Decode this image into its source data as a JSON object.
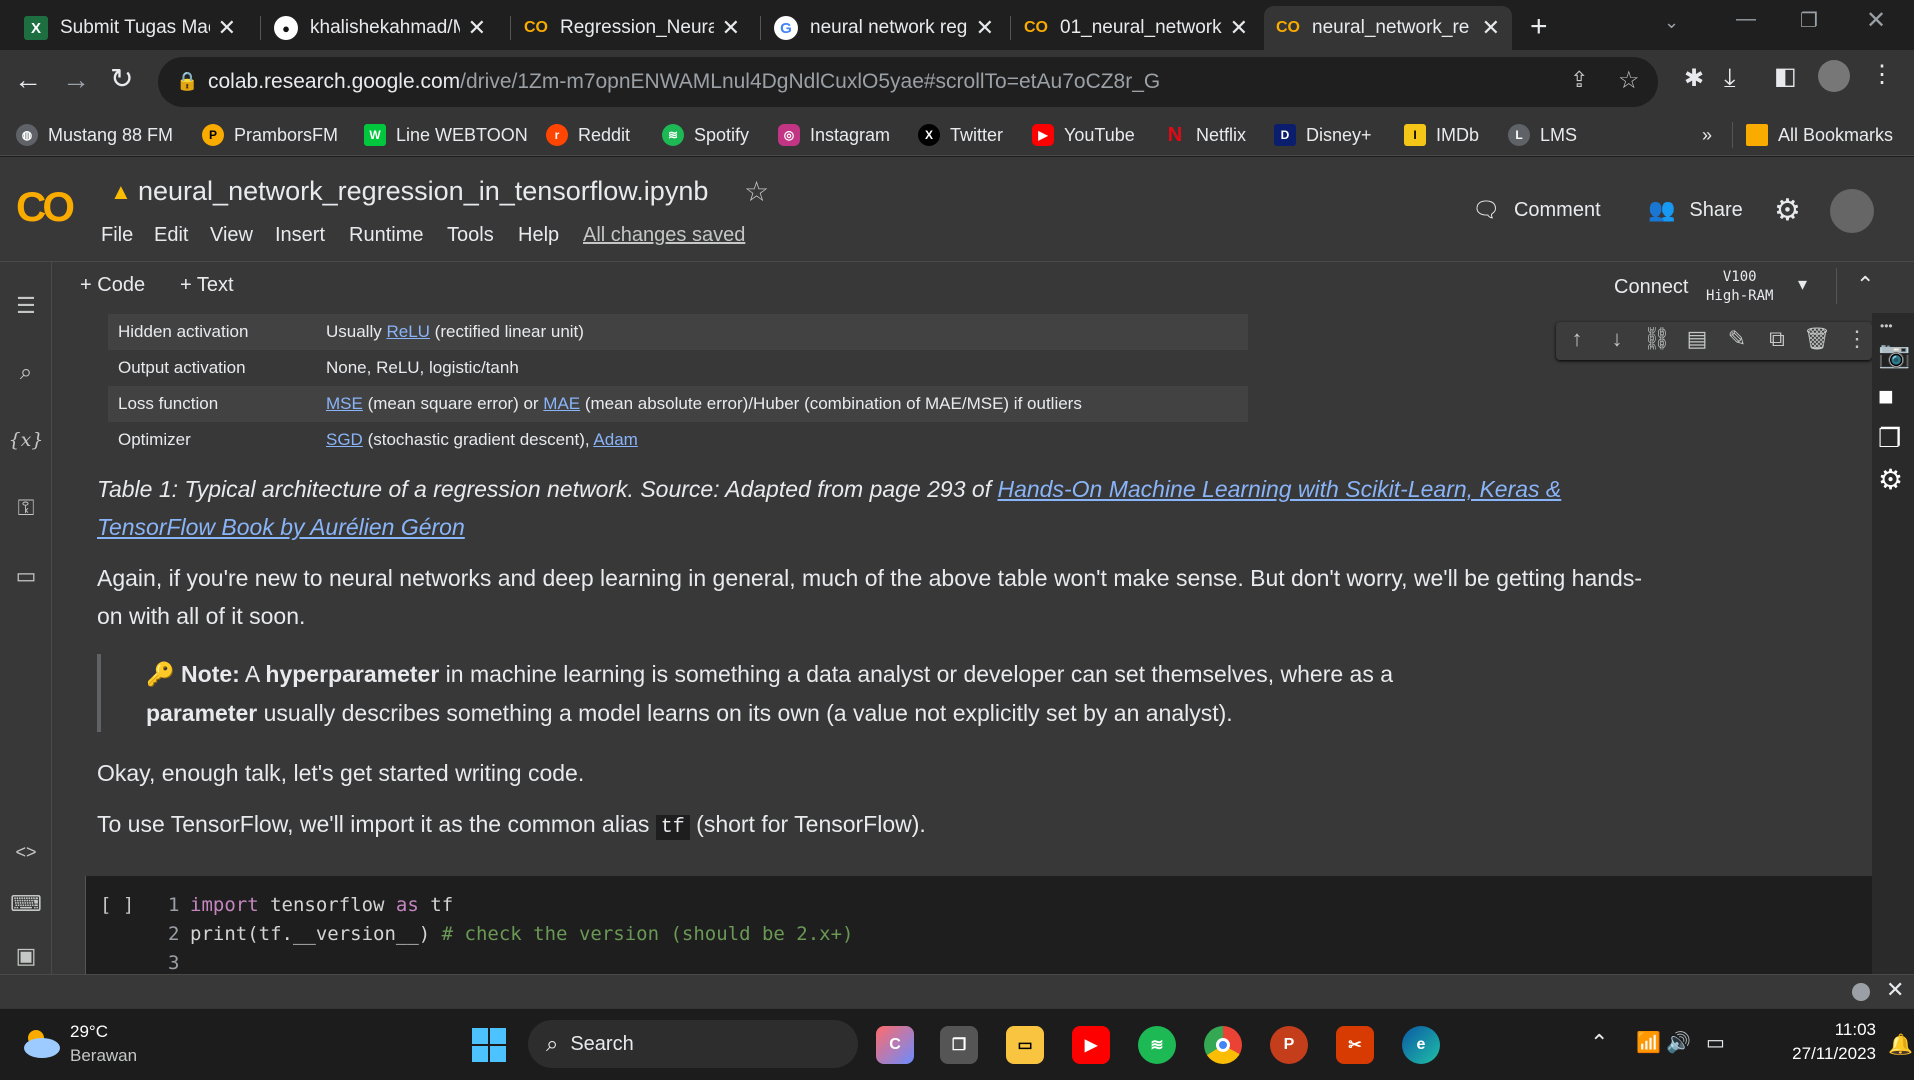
{
  "browser": {
    "tabs": [
      {
        "title": "Submit Tugas Mac",
        "icon": "excel-icon"
      },
      {
        "title": "khalishekahmad/M",
        "icon": "github-icon"
      },
      {
        "title": "Regression_Neural",
        "icon": "colab-icon"
      },
      {
        "title": "neural network reg",
        "icon": "google-icon"
      },
      {
        "title": "01_neural_network",
        "icon": "colab-icon"
      },
      {
        "title": "neural_network_re",
        "icon": "colab-icon"
      }
    ],
    "url_host": "colab.research.google.com",
    "url_path": "/drive/1Zm-m7opnENWAMLnul4DgNdlCuxlO5yae#scrollTo=etAu7oCZ8r_G",
    "bookmarks": [
      "Mustang 88 FM",
      "PramborsFM",
      "Line WEBTOON",
      "Reddit",
      "Spotify",
      "Instagram",
      "Twitter",
      "YouTube",
      "Netflix",
      "Disney+",
      "IMDb",
      "LMS"
    ],
    "all_bookmarks": "All Bookmarks",
    "overflow": "»"
  },
  "colab": {
    "logo": "CO",
    "filename": "neural_network_regression_in_tensorflow.ipynb",
    "menu": [
      "File",
      "Edit",
      "View",
      "Insert",
      "Runtime",
      "Tools",
      "Help"
    ],
    "saved": "All changes saved",
    "comment": "Comment",
    "share": "Share",
    "add_code": "Code",
    "add_text": "Text",
    "connect": "Connect",
    "runtime_gpu": "V100",
    "runtime_ram": "High-RAM"
  },
  "table": {
    "rows": [
      {
        "label": "Hidden activation",
        "pre": "Usually ",
        "link": "ReLU",
        "post": " (rectified linear unit)"
      },
      {
        "label": "Output activation",
        "pre": "None, ReLU, logistic/tanh",
        "link": "",
        "post": ""
      },
      {
        "label": "Loss function",
        "pre": "",
        "link": "MSE",
        "post": " (mean square error) or ",
        "link2": "MAE",
        "post2": " (mean absolute error)/Huber (combination of MAE/MSE) if outliers"
      },
      {
        "label": "Optimizer",
        "pre": "",
        "link": "SGD",
        "post": " (stochastic gradient descent), ",
        "link2": "Adam",
        "post2": ""
      }
    ]
  },
  "text": {
    "caption_pre": "Table 1: Typical architecture of a regression network. Source: Adapted from page 293 of ",
    "caption_link1": "Hands-On Machine Learning with Scikit-Learn, Keras &",
    "caption_link2": "TensorFlow Book by Aurélien Géron",
    "para1": "Again, if you're new to neural networks and deep learning in general, much of the above table won't make sense. But don't worry, we'll be getting hands-on with all of it soon.",
    "note_emoji": "🔑",
    "note_label": "Note:",
    "note_a": " A ",
    "note_b": "hyperparameter",
    "note_c": " in machine learning is something a data analyst or developer can set themselves, where as a",
    "note_d": "parameter",
    "note_e": " usually describes something a model learns on its own (a value not explicitly set by an analyst).",
    "para2": "Okay, enough talk, let's get started writing code.",
    "para3_pre": "To use TensorFlow, we'll import it as the common alias ",
    "para3_code": "tf",
    "para3_post": " (short for TensorFlow)."
  },
  "code": {
    "run_label": "[ ]",
    "ln1": "1",
    "ln2": "2",
    "ln3": "3",
    "kw_import": "import",
    "mod": " tensorflow ",
    "kw_as": "as",
    "alias": " tf",
    "print_a": "print(tf.__version__) ",
    "comment": "# check the version (should be 2.x+)"
  },
  "taskbar": {
    "temp": "29°C",
    "weather": "Berawan",
    "search": "Search",
    "time": "11:03",
    "date": "27/11/2023"
  }
}
